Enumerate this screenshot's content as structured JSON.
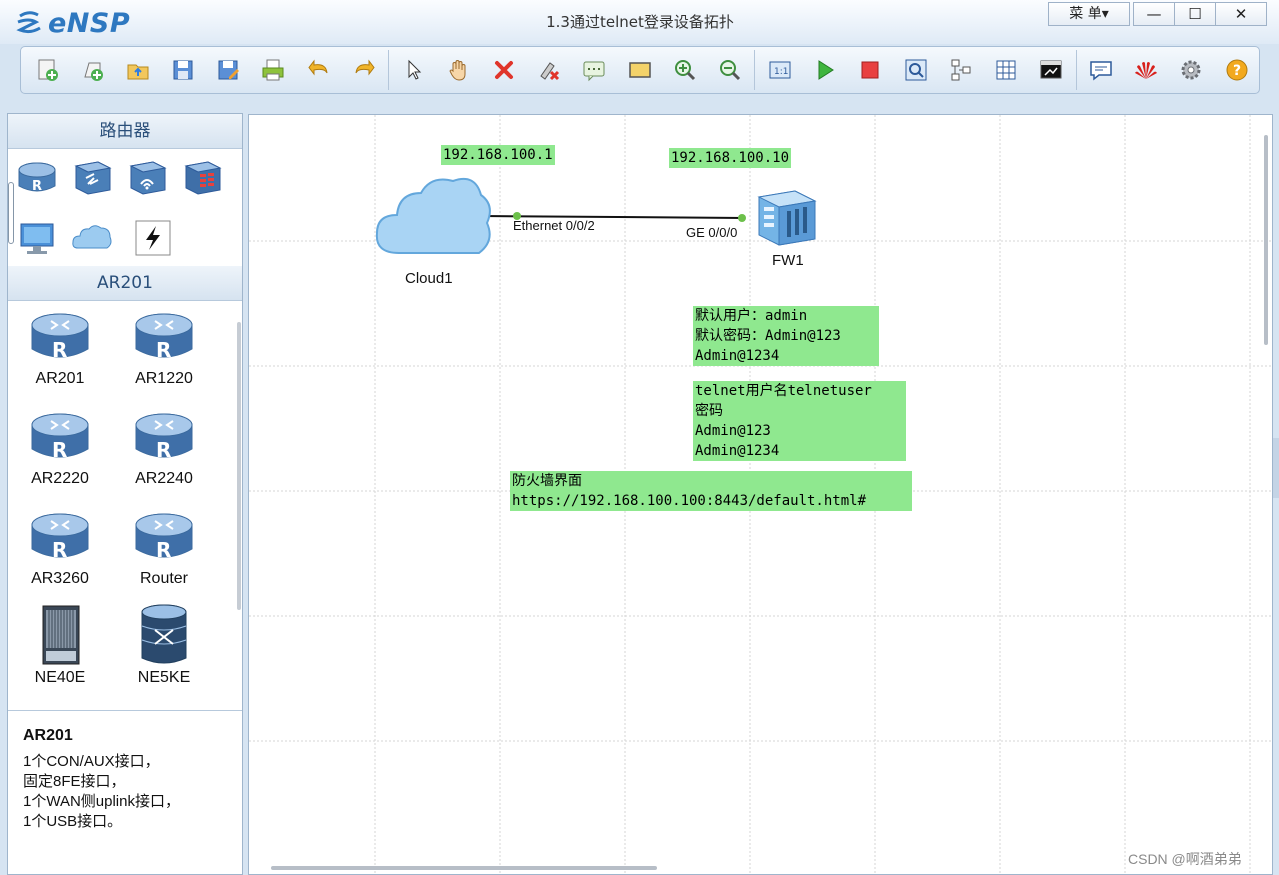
{
  "window": {
    "app_name": "eNSP",
    "title": "1.3通过telnet登录设备拓扑",
    "menu_label": "菜 单▾",
    "minimize": "—",
    "maximize": "☐",
    "close": "✕"
  },
  "toolbar": {
    "items": [
      "new-topology",
      "new-lab",
      "open",
      "save",
      "save-as",
      "print",
      "undo",
      "redo",
      "select",
      "pan",
      "delete",
      "delete-link",
      "text",
      "rectangle",
      "zoom-in",
      "zoom-out",
      "fit",
      "start",
      "stop",
      "capture",
      "topology",
      "grid",
      "console",
      "chat",
      "huawei",
      "settings",
      "help"
    ]
  },
  "left_panel": {
    "category_header": "路由器",
    "category_icons": [
      "router-icon",
      "switch-icon",
      "wireless-icon",
      "firewall-icon",
      "pc-icon",
      "cloud-icon",
      "link-icon"
    ],
    "device_group_header": "AR201",
    "devices": [
      {
        "label": "AR201",
        "icon": "router-icon"
      },
      {
        "label": "AR1220",
        "icon": "router-icon"
      },
      {
        "label": "AR2220",
        "icon": "router-icon"
      },
      {
        "label": "AR2240",
        "icon": "router-icon"
      },
      {
        "label": "AR3260",
        "icon": "router-icon"
      },
      {
        "label": "Router",
        "icon": "router-icon"
      },
      {
        "label": "NE40E",
        "icon": "chassis-icon"
      },
      {
        "label": "NE5KE",
        "icon": "core-router-icon"
      }
    ],
    "description": {
      "title": "AR201",
      "lines": [
        "1个CON/AUX接口，",
        "固定8FE接口，",
        "1个WAN侧uplink接口，",
        "1个USB接口。"
      ]
    }
  },
  "canvas": {
    "nodes": [
      {
        "name": "Cloud1",
        "icon": "cloud-icon"
      },
      {
        "name": "FW1",
        "icon": "firewall-icon"
      }
    ],
    "link": {
      "left_port": "Ethernet 0/0/2",
      "right_port": "GE 0/0/0"
    },
    "notes": [
      {
        "id": "ip-cloud",
        "lines": [
          "192.168.100.1"
        ]
      },
      {
        "id": "ip-fw",
        "lines": [
          "192.168.100.10"
        ]
      },
      {
        "id": "default-creds",
        "lines": [
          "默认用户：admin",
          "默认密码：Admin@123",
          "Admin@1234"
        ]
      },
      {
        "id": "telnet-creds",
        "lines": [
          "telnet用户名telnetuser",
          "密码",
          "Admin@123",
          "Admin@1234"
        ]
      },
      {
        "id": "fw-web",
        "lines": [
          "防火墙界面",
          "https://192.168.100.100:8443/default.html#"
        ]
      }
    ],
    "colors": {
      "note_bg": "#8fe88f",
      "link_dot": "#6cc04a"
    }
  },
  "watermark": "CSDN @啊酒弟弟"
}
